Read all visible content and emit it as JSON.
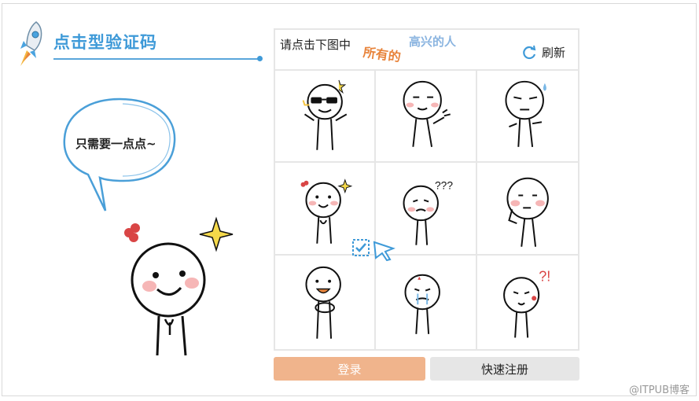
{
  "header": {
    "title": "点击型验证码"
  },
  "bubble": {
    "text": "只需要一点点~"
  },
  "captcha": {
    "prompt": "请点击下图中",
    "target_part1": "所有的",
    "target_part2": "高兴的人",
    "refresh_label": "刷新",
    "cells": [
      {
        "name": "emoji-sunglasses"
      },
      {
        "name": "emoji-smirk-wave"
      },
      {
        "name": "emoji-sweat-shrug"
      },
      {
        "name": "emoji-shy-flower"
      },
      {
        "name": "emoji-confused"
      },
      {
        "name": "emoji-thinking"
      },
      {
        "name": "emoji-eating"
      },
      {
        "name": "emoji-crying"
      },
      {
        "name": "emoji-surprised"
      }
    ],
    "annotations": {
      "cell4": "???",
      "cell9": "?!"
    }
  },
  "buttons": {
    "login": "登录",
    "register": "快速注册"
  },
  "watermark": "@ITPUB博客",
  "colors": {
    "accent": "#3f9ad8",
    "login": "#f0b48c",
    "register": "#e6e6e6",
    "target": "#e8843c"
  }
}
